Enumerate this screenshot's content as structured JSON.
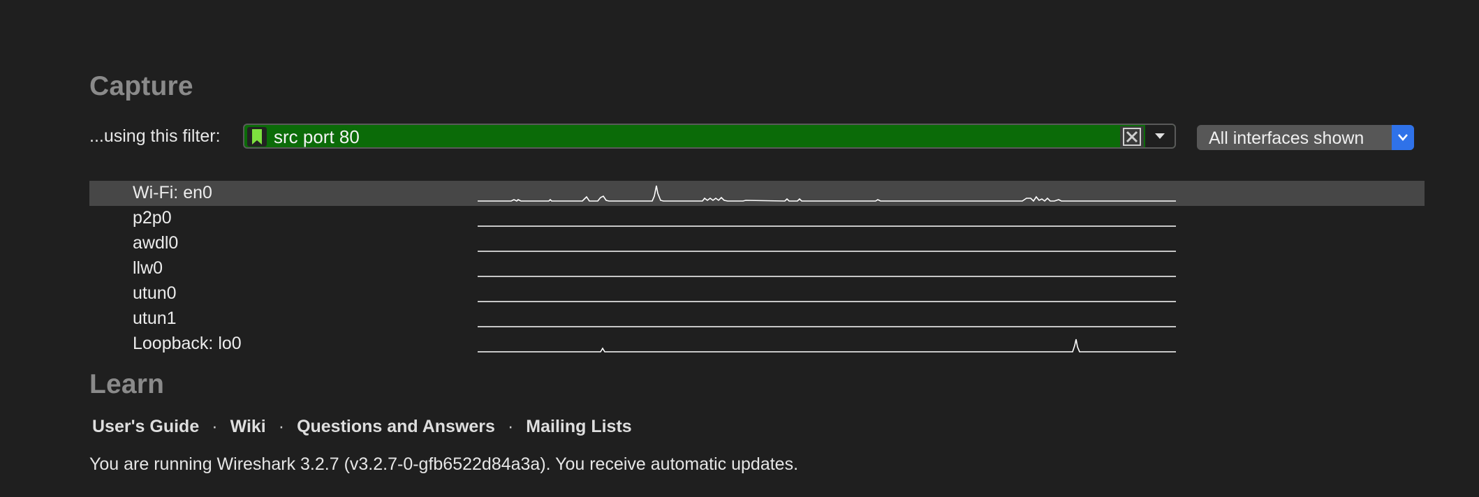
{
  "capture": {
    "title": "Capture",
    "filter_label": "...using this filter:",
    "filter_value": "src port 80",
    "filter_color": "#0b6b08",
    "interfaces_dropdown": "All interfaces shown",
    "interfaces": [
      {
        "name": "Wi-Fi: en0",
        "selected": true
      },
      {
        "name": "p2p0",
        "selected": false
      },
      {
        "name": "awdl0",
        "selected": false
      },
      {
        "name": "llw0",
        "selected": false
      },
      {
        "name": "utun0",
        "selected": false
      },
      {
        "name": "utun1",
        "selected": false
      },
      {
        "name": "Loopback: lo0",
        "selected": false
      }
    ]
  },
  "learn": {
    "title": "Learn",
    "links": [
      "User's Guide",
      "Wiki",
      "Questions and Answers",
      "Mailing Lists"
    ],
    "separator": "·"
  },
  "status": {
    "text": "You are running Wireshark 3.2.7 (v3.2.7-0-gfb6522d84a3a). You receive automatic updates."
  },
  "icons": {
    "bookmark": "bookmark-icon",
    "clear": "clear-filter-icon",
    "dropdown": "chevron-down-icon"
  }
}
